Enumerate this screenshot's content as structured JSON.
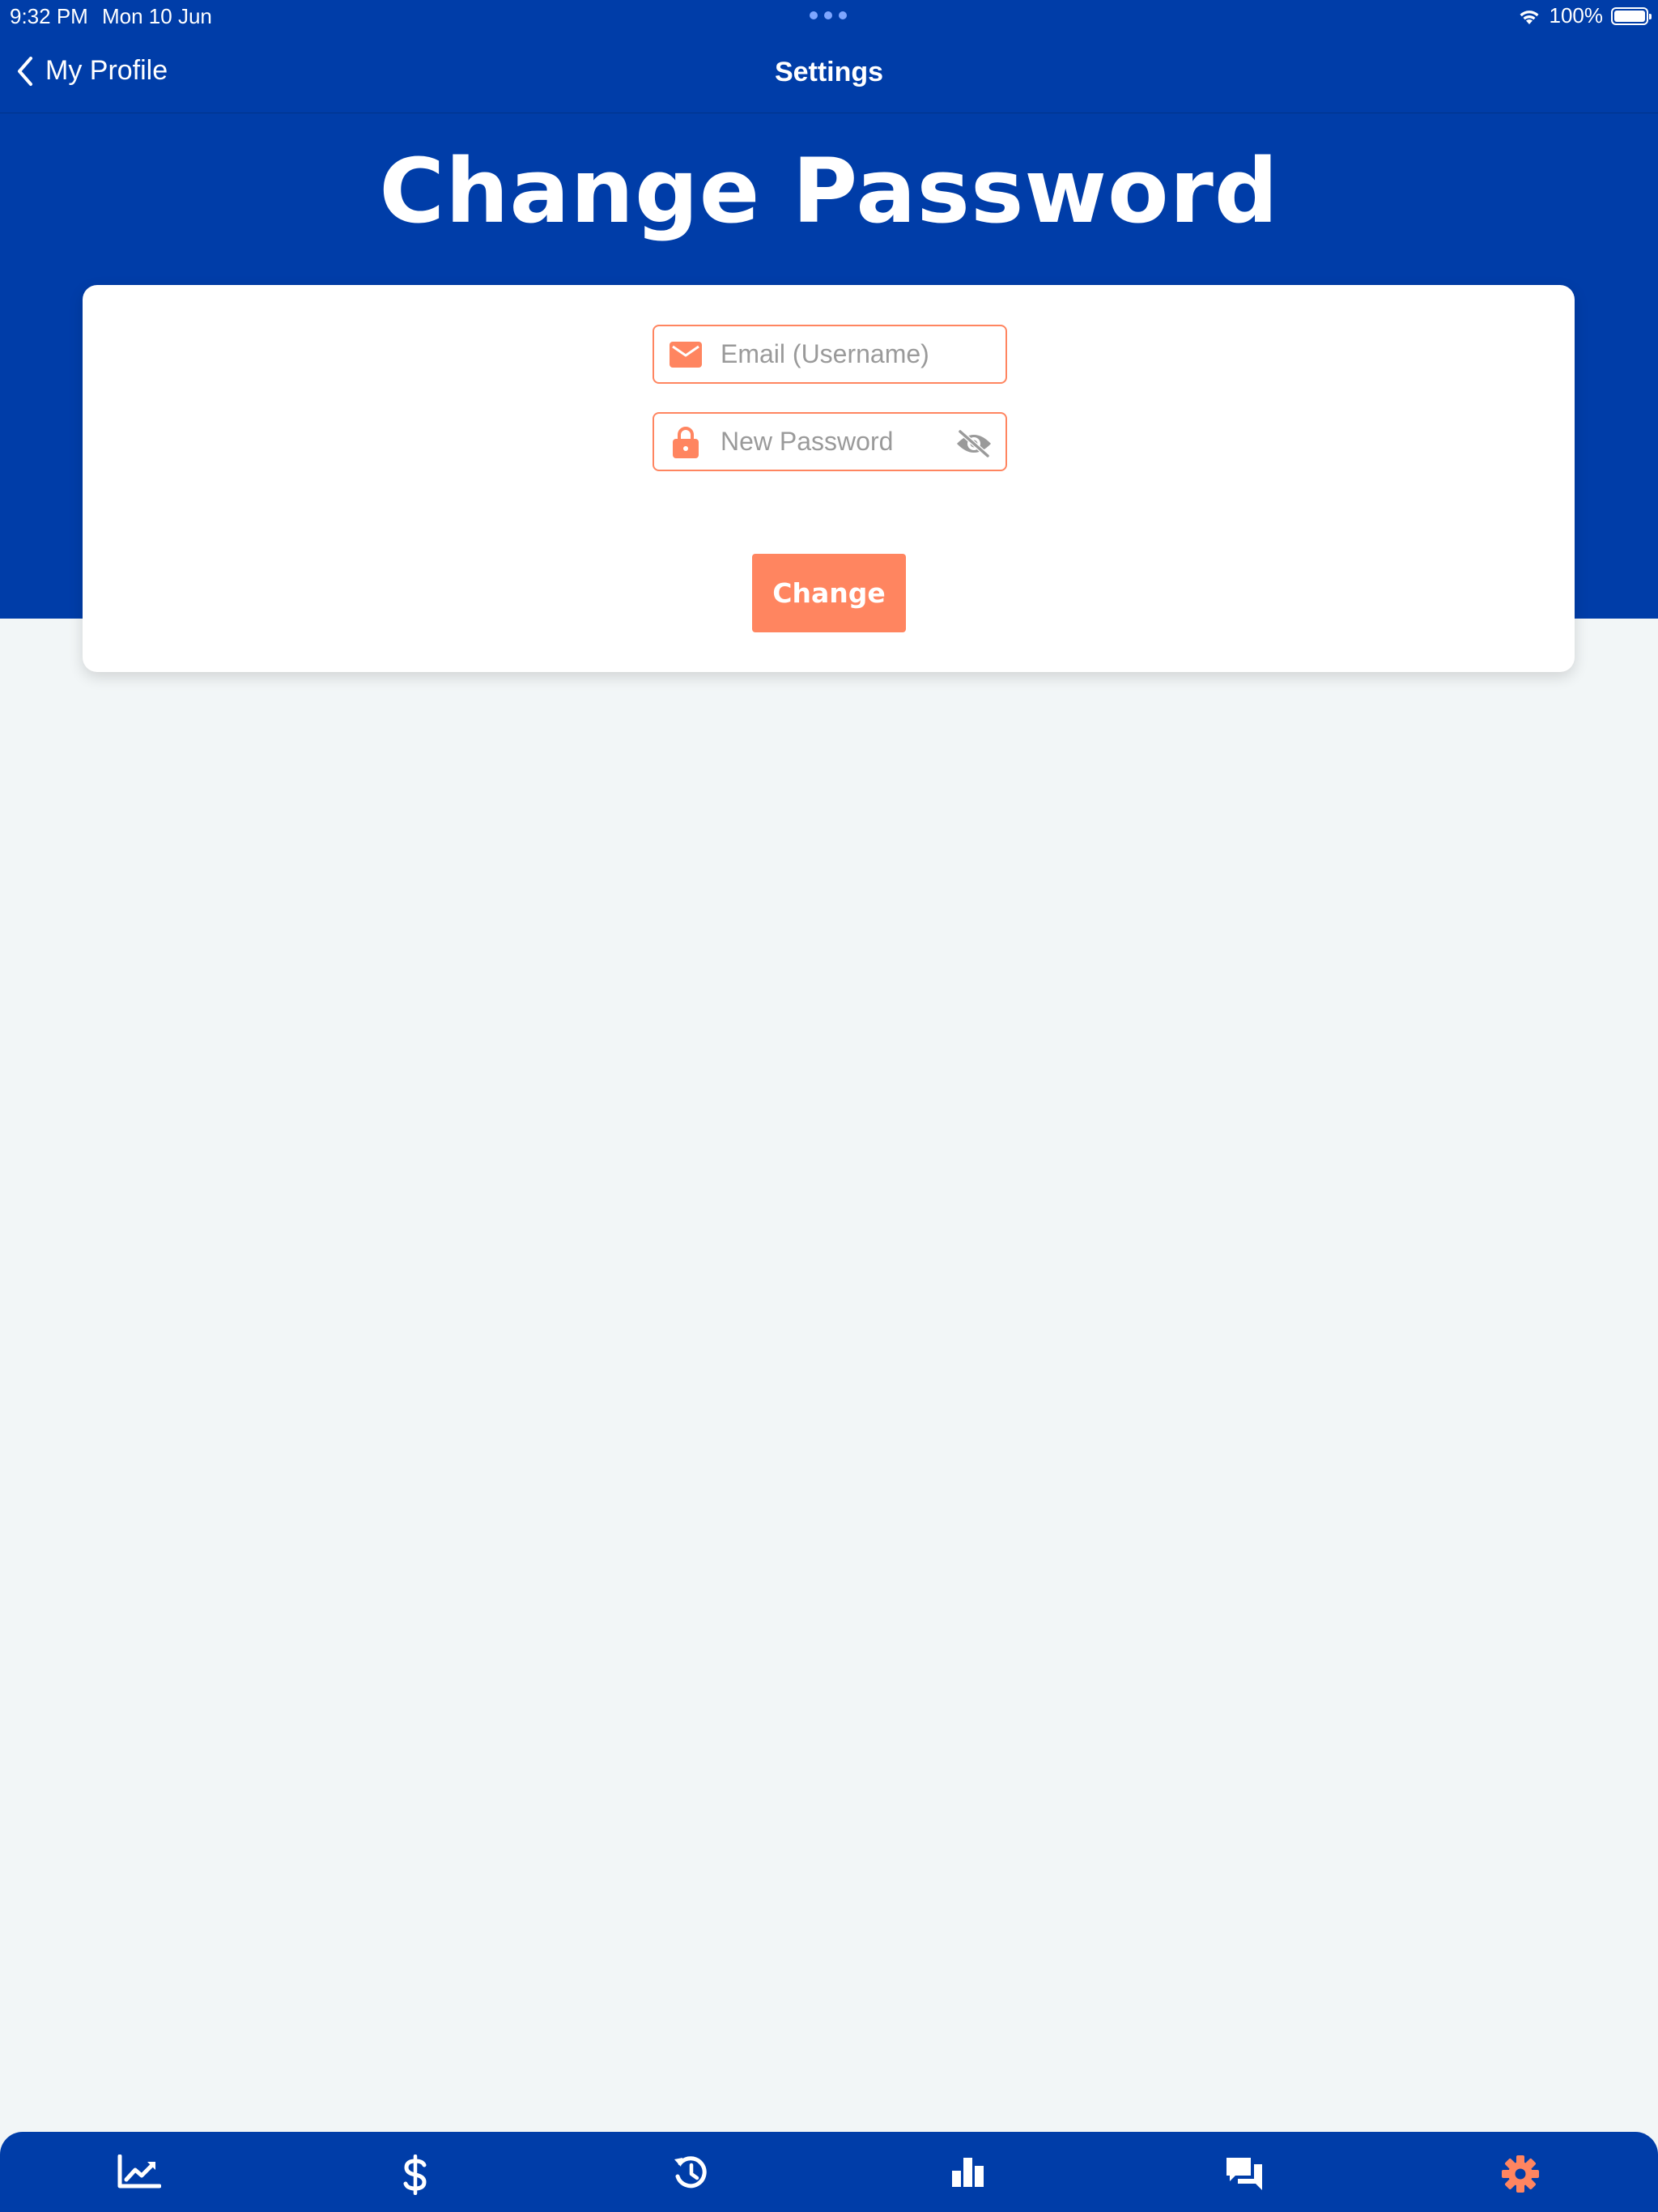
{
  "status_bar": {
    "time": "9:32 PM",
    "date": "Mon 10 Jun",
    "battery": "100%"
  },
  "nav": {
    "back_label": "My Profile",
    "title": "Settings"
  },
  "page": {
    "title": "Change Password"
  },
  "form": {
    "email_placeholder": "Email (Username)",
    "email_value": "",
    "password_placeholder": "New Password",
    "password_value": "",
    "submit_label": "Change"
  },
  "tab_bar": {
    "items": [
      {
        "icon": "trending-chart-icon",
        "active": false
      },
      {
        "icon": "dollar-icon",
        "active": false
      },
      {
        "icon": "history-icon",
        "active": false
      },
      {
        "icon": "bar-chart-icon",
        "active": false
      },
      {
        "icon": "chat-icon",
        "active": false
      },
      {
        "icon": "gear-icon",
        "active": true
      }
    ]
  },
  "colors": {
    "primary": "#003da8",
    "accent": "#ff8560",
    "background": "#f2f6f7",
    "card": "#ffffff"
  }
}
